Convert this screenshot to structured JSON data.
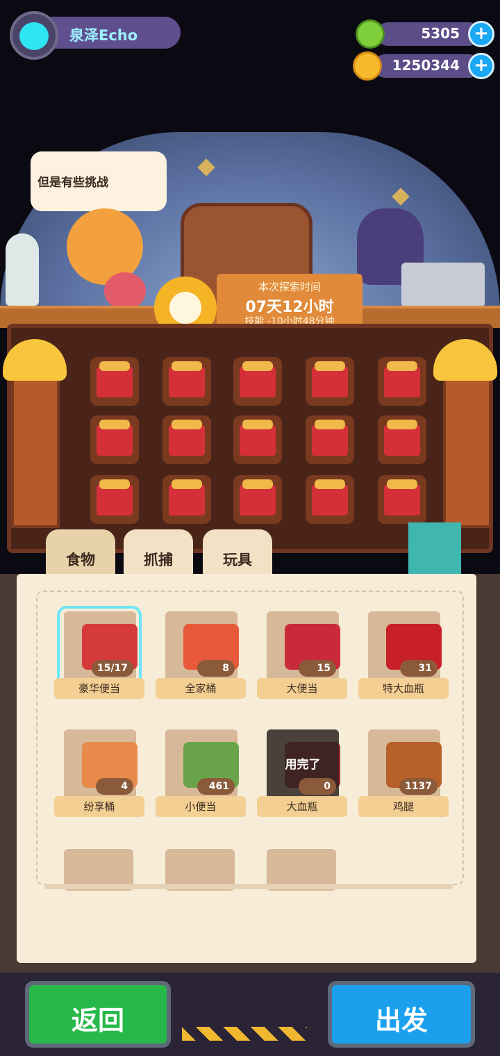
{
  "player": {
    "name": "泉泽Echo"
  },
  "currencies": [
    {
      "icon": "green-gem-icon",
      "value": "5305"
    },
    {
      "icon": "gold-coin-icon",
      "value": "1250344"
    }
  ],
  "speech": "但是有些挑战",
  "exploration": {
    "title": "本次探索时间",
    "duration": "07天12小时",
    "skill": "技能 -10小时48分钟"
  },
  "tabs": [
    {
      "label": "食物",
      "active": true
    },
    {
      "label": "抓捕",
      "active": false
    },
    {
      "label": "玩具",
      "active": false
    }
  ],
  "items": [
    {
      "name": "豪华便当",
      "count": "15/17",
      "selected": true,
      "used_up": false,
      "color": "#d43a3a"
    },
    {
      "name": "全家桶",
      "count": "8",
      "selected": false,
      "used_up": false,
      "color": "#e8583a"
    },
    {
      "name": "大便当",
      "count": "15",
      "selected": false,
      "used_up": false,
      "color": "#c92a3a"
    },
    {
      "name": "特大血瓶",
      "count": "31",
      "selected": false,
      "used_up": false,
      "color": "#c8202a"
    },
    {
      "name": "纷享桶",
      "count": "4",
      "selected": false,
      "used_up": false,
      "color": "#e88a4a"
    },
    {
      "name": "小便当",
      "count": "461",
      "selected": false,
      "used_up": false,
      "color": "#6aa44a"
    },
    {
      "name": "大血瓶",
      "count": "0",
      "selected": false,
      "used_up": true,
      "used_label": "用完了",
      "color": "#a02a2a"
    },
    {
      "name": "鸡腿",
      "count": "1137",
      "selected": false,
      "used_up": false,
      "color": "#b8602a"
    }
  ],
  "buttons": {
    "back": "返回",
    "go": "出发"
  }
}
